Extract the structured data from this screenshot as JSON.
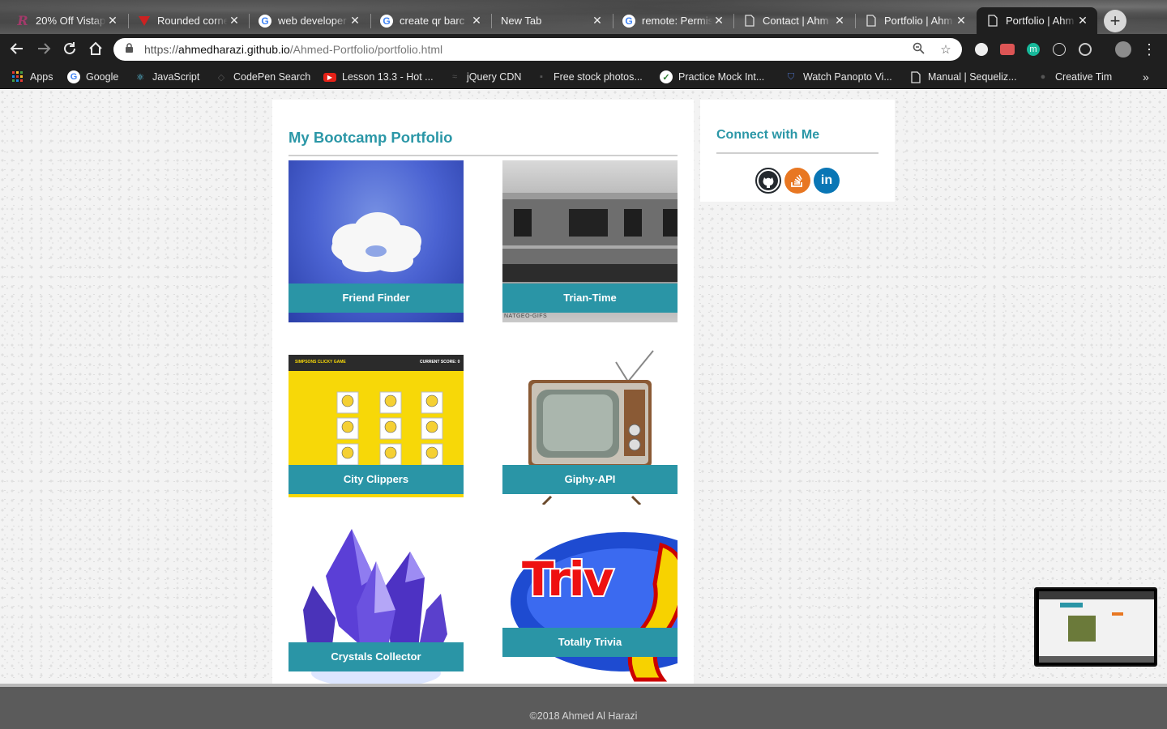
{
  "browser": {
    "tabs": [
      {
        "title": "20% Off Vistap",
        "icon": "r-logo-icon",
        "color": "#a23a6a"
      },
      {
        "title": "Rounded corne",
        "icon": "red-triangle-icon",
        "color": "#cc2222"
      },
      {
        "title": "web developer",
        "icon": "google-icon",
        "color": "#4285f4"
      },
      {
        "title": "create qr barc",
        "icon": "google-icon",
        "color": "#4285f4"
      },
      {
        "title": "New Tab",
        "icon": "",
        "color": ""
      },
      {
        "title": "remote: Permis",
        "icon": "google-icon",
        "color": "#4285f4"
      },
      {
        "title": "Contact | Ahm",
        "icon": "page-icon",
        "color": "#ddd"
      },
      {
        "title": "Portfolio | Ahm",
        "icon": "page-icon",
        "color": "#ddd"
      },
      {
        "title": "Portfolio | Ahm",
        "icon": "page-icon",
        "color": "#ddd"
      }
    ],
    "new_tab_label": "+",
    "url_host": "ahmedharazi.github.io",
    "url_prefix": "https://",
    "url_path": "/Ahmed-Portfolio/portfolio.html",
    "bookmarks": [
      {
        "label": "Apps",
        "icon": "apps-grid-icon"
      },
      {
        "label": "Google",
        "icon": "google-icon"
      },
      {
        "label": "JavaScript",
        "icon": "react-icon"
      },
      {
        "label": "CodePen Search",
        "icon": "codepen-icon"
      },
      {
        "label": "Lesson 13.3 - Hot ...",
        "icon": "youtube-icon"
      },
      {
        "label": "jQuery CDN",
        "icon": "jquery-icon"
      },
      {
        "label": "Free stock photos...",
        "icon": "pexels-icon"
      },
      {
        "label": "Practice Mock Int...",
        "icon": "check-icon"
      },
      {
        "label": "Watch Panopto Vi...",
        "icon": "panopto-icon"
      },
      {
        "label": "Manual | Sequeliz...",
        "icon": "page-icon"
      },
      {
        "label": "Creative Tim",
        "icon": "creative-tim-icon"
      }
    ],
    "more_bookmarks": "»"
  },
  "page": {
    "title": "My Bootcamp Portfolio",
    "projects": [
      {
        "name": "Friend Finder",
        "art": "cloud"
      },
      {
        "name": "Trian-Time",
        "art": "train"
      },
      {
        "name": "City Clippers",
        "art": "simpsons"
      },
      {
        "name": "Giphy-API",
        "art": "tv"
      },
      {
        "name": "Crystals Collector",
        "art": "crystal"
      },
      {
        "name": "Totally Trivia",
        "art": "trivia"
      }
    ],
    "train_caption": "NATGEO-GIFS",
    "simpsons_header": "SIMPSONS CLICKY GAME",
    "simpsons_score": "CURRENT SCORE: 0",
    "trivia_art_text": "Triv",
    "sidebar": {
      "title": "Connect with Me",
      "links": [
        {
          "name": "github-icon",
          "color": "#24292e"
        },
        {
          "name": "stackoverflow-icon",
          "color": "#e87722"
        },
        {
          "name": "linkedin-icon",
          "color": "#0a76b5",
          "label": "in"
        }
      ]
    },
    "footer": {
      "copyright": "©2018 Ahmed Al Harazi"
    }
  },
  "colors": {
    "accent": "#2b97a7",
    "caption_bg": "#2a95a6",
    "footer_bg": "#5b5b5b"
  }
}
